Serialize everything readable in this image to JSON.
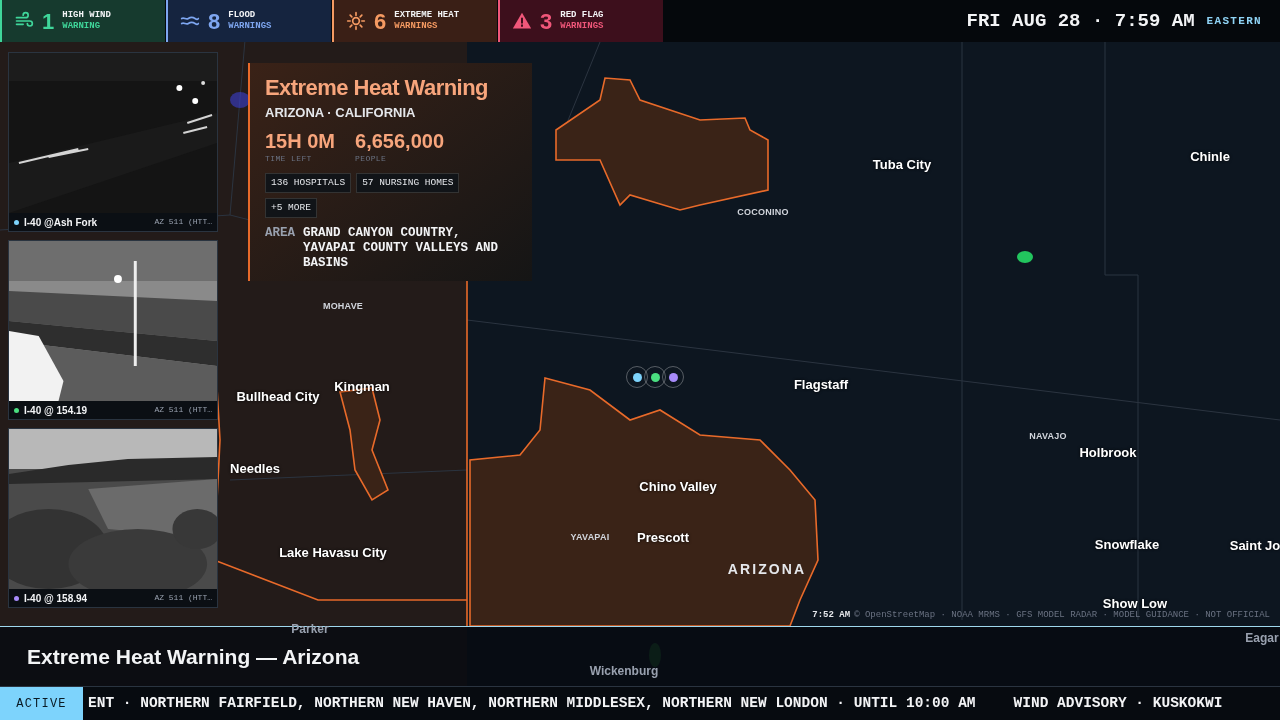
{
  "alerts_bar": [
    {
      "kind": "wind",
      "count": "1",
      "line1": "HIGH WIND",
      "line2": "WARNING",
      "color": "#3fd69a"
    },
    {
      "kind": "flood",
      "count": "8",
      "line1": "FLOOD",
      "line2": "WARNINGS",
      "color": "#7ea6f0"
    },
    {
      "kind": "heat",
      "count": "6",
      "line1": "EXTREME HEAT",
      "line2": "WARNINGS",
      "color": "#f59a62"
    },
    {
      "kind": "flag",
      "count": "3",
      "line1": "RED FLAG",
      "line2": "WARNINGS",
      "color": "#f0577a"
    }
  ],
  "clock": {
    "text": "FRI AUG 28 · 7:59 AM",
    "zone": "EASTERN"
  },
  "cameras": [
    {
      "kind": "night",
      "name": "I-40 @Ash Fork",
      "source": "AZ 511 (HTT…",
      "color": "#7dd3fc"
    },
    {
      "kind": "road",
      "name": "I-40 @ 154.19",
      "source": "AZ 511 (HTT…",
      "color": "#4ade80"
    },
    {
      "kind": "field",
      "name": "I-40 @ 158.94",
      "source": "AZ 511 (HTT…",
      "color": "#a78bfa"
    }
  ],
  "alert_card": {
    "title": "Extreme Heat Warning",
    "regions": "ARIZONA · CALIFORNIA",
    "stats": [
      {
        "value": "15H 0M",
        "label": "TIME LEFT"
      },
      {
        "value": "6,656,000",
        "label": "PEOPLE"
      }
    ],
    "tags": [
      "136 HOSPITALS",
      "57 NURSING HOMES",
      "+5 MORE"
    ],
    "area_label": "AREA",
    "area": "GRAND CANYON COUNTRY, YAVAPAI COUNTY VALLEYS AND BASINS"
  },
  "map": {
    "labels": [
      {
        "text": "Tuba City",
        "kind": "city"
      },
      {
        "text": "Chinle",
        "kind": "city"
      },
      {
        "text": "COCONINO",
        "kind": "county"
      },
      {
        "text": "MOHAVE",
        "kind": "county"
      },
      {
        "text": "Kingman",
        "kind": "city"
      },
      {
        "text": "Bullhead City",
        "kind": "city"
      },
      {
        "text": "Flagstaff",
        "kind": "city"
      },
      {
        "text": "NAVAJO",
        "kind": "county"
      },
      {
        "text": "Holbrook",
        "kind": "city"
      },
      {
        "text": "Needles",
        "kind": "city"
      },
      {
        "text": "Chino Valley",
        "kind": "city"
      },
      {
        "text": "YAVAPAI",
        "kind": "county"
      },
      {
        "text": "Prescott",
        "kind": "city"
      },
      {
        "text": "Snowflake",
        "kind": "city"
      },
      {
        "text": "Saint Jo",
        "kind": "city"
      },
      {
        "text": "Lake Havasu City",
        "kind": "city"
      },
      {
        "text": "ARIZONA",
        "kind": "state"
      },
      {
        "text": "Show Low",
        "kind": "city"
      },
      {
        "text": "Parker",
        "kind": "faded"
      },
      {
        "text": "Eagar",
        "kind": "faded"
      },
      {
        "text": "Wickenburg",
        "kind": "faded"
      }
    ],
    "attribution_time": "7:52 AM",
    "attribution": "© OpenStreetMap · NOAA MRMS · GFS MODEL RADAR · MODEL GUIDANCE · NOT OFFICIAL"
  },
  "banner": {
    "title": "Extreme Heat Warning — Arizona"
  },
  "ticker": {
    "label": "ACTIVE",
    "items": [
      "ENT · NORTHERN FAIRFIELD, NORTHERN NEW HAVEN, NORTHERN MIDDLESEX, NORTHERN NEW LONDON · UNTIL 10:00 AM",
      "WIND ADVISORY · KUSKOKWI"
    ]
  }
}
